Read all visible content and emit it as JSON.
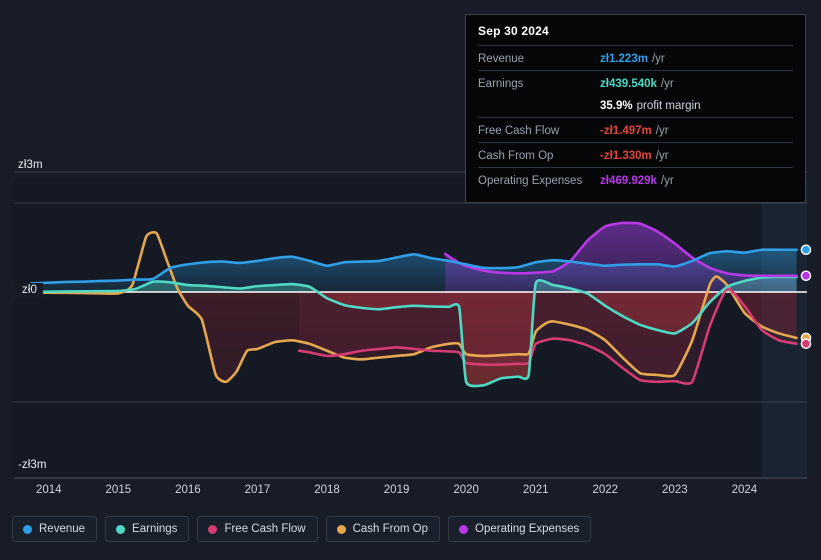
{
  "tooltip": {
    "date": "Sep 30 2024",
    "rows": [
      {
        "label": "Revenue",
        "value": "zł1.223m",
        "unit": "/yr",
        "color": "#2f9fe8"
      },
      {
        "label": "Earnings",
        "value": "zł439.540k",
        "unit": "/yr",
        "color": "#4fd8c4"
      },
      {
        "label": "",
        "value": "35.9%",
        "unit": "profit margin",
        "color": "#ffffff"
      },
      {
        "label": "Free Cash Flow",
        "value": "-zł1.497m",
        "unit": "/yr",
        "color": "#e4453a"
      },
      {
        "label": "Cash From Op",
        "value": "-zł1.330m",
        "unit": "/yr",
        "color": "#e4453a"
      },
      {
        "label": "Operating Expenses",
        "value": "zł469.929k",
        "unit": "/yr",
        "color": "#b838e8"
      }
    ]
  },
  "legend": {
    "items": [
      {
        "label": "Revenue",
        "color": "#2f9fe8"
      },
      {
        "label": "Earnings",
        "color": "#4fd8c4"
      },
      {
        "label": "Free Cash Flow",
        "color": "#d63b74"
      },
      {
        "label": "Cash From Op",
        "color": "#e5a84e"
      },
      {
        "label": "Operating Expenses",
        "color": "#b838e8"
      }
    ]
  },
  "chart_data": {
    "type": "area",
    "title": "",
    "xlabel": "",
    "ylabel": "",
    "currency": "zł",
    "grid": true,
    "legend_position": "bottom",
    "ylim": [
      -3000000,
      3000000
    ],
    "ytick_labels": [
      "zł3m",
      "zł0",
      "-zł3m"
    ],
    "ytick_values": [
      3000000,
      0,
      -3000000
    ],
    "xlim": [
      2013.5,
      2024.9
    ],
    "xtick_labels": [
      "2014",
      "2015",
      "2016",
      "2017",
      "2018",
      "2019",
      "2020",
      "2021",
      "2022",
      "2023",
      "2024"
    ],
    "xtick_values": [
      2014,
      2015,
      2016,
      2017,
      2018,
      2019,
      2020,
      2021,
      2022,
      2023,
      2024
    ],
    "forecast_start": 2024.25,
    "series": [
      {
        "name": "Revenue",
        "color": "#2f9fe8",
        "x": [
          2013.75,
          2014.0,
          2014.25,
          2014.5,
          2014.75,
          2015.0,
          2015.25,
          2015.5,
          2015.75,
          2016.0,
          2016.25,
          2016.5,
          2016.75,
          2017.0,
          2017.25,
          2017.5,
          2017.75,
          2018.0,
          2018.25,
          2018.5,
          2018.75,
          2019.0,
          2019.25,
          2019.5,
          2019.75,
          2020.0,
          2020.25,
          2020.5,
          2020.75,
          2021.0,
          2021.25,
          2021.5,
          2021.75,
          2022.0,
          2022.25,
          2022.5,
          2022.75,
          2023.0,
          2023.25,
          2023.5,
          2023.75,
          2024.0,
          2024.25,
          2024.5,
          2024.75
        ],
        "values": [
          250000,
          270000,
          290000,
          300000,
          320000,
          330000,
          360000,
          380000,
          700000,
          800000,
          860000,
          880000,
          840000,
          900000,
          980000,
          1020000,
          900000,
          760000,
          860000,
          880000,
          900000,
          1000000,
          1090000,
          980000,
          900000,
          800000,
          700000,
          690000,
          720000,
          860000,
          920000,
          880000,
          820000,
          760000,
          790000,
          800000,
          800000,
          740000,
          900000,
          1120000,
          1180000,
          1140000,
          1223000,
          1223000,
          1223000
        ]
      },
      {
        "name": "Earnings",
        "color": "#4fd8c4",
        "x": [
          2013.75,
          2014.0,
          2014.5,
          2015.0,
          2015.25,
          2015.5,
          2015.75,
          2016.0,
          2016.25,
          2016.5,
          2016.75,
          2017.0,
          2017.25,
          2017.5,
          2017.75,
          2018.0,
          2018.25,
          2018.5,
          2018.75,
          2019.0,
          2019.25,
          2019.5,
          2019.75,
          2019.9,
          2020.0,
          2020.25,
          2020.5,
          2020.75,
          2020.9,
          2021.0,
          2021.25,
          2021.5,
          2021.75,
          2022.0,
          2022.25,
          2022.5,
          2022.75,
          2023.0,
          2023.25,
          2023.5,
          2023.75,
          2024.0,
          2024.25,
          2024.5,
          2024.75
        ],
        "values": [
          0,
          10000,
          20000,
          30000,
          90000,
          300000,
          280000,
          200000,
          180000,
          140000,
          100000,
          170000,
          200000,
          230000,
          150000,
          -180000,
          -380000,
          -460000,
          -500000,
          -440000,
          -400000,
          -420000,
          -430000,
          -440000,
          -2600000,
          -2700000,
          -2500000,
          -2450000,
          -2400000,
          250000,
          200000,
          100000,
          -50000,
          -400000,
          -700000,
          -950000,
          -1100000,
          -1200000,
          -900000,
          -300000,
          150000,
          320000,
          420000,
          439540,
          439540
        ]
      },
      {
        "name": "Free Cash Flow",
        "color": "#d63b74",
        "x": [
          2017.6,
          2017.75,
          2018.0,
          2018.25,
          2018.5,
          2018.75,
          2019.0,
          2019.25,
          2019.5,
          2019.75,
          2019.9,
          2020.0,
          2020.25,
          2020.5,
          2020.75,
          2020.9,
          2021.0,
          2021.25,
          2021.5,
          2021.75,
          2022.0,
          2022.25,
          2022.5,
          2022.75,
          2023.0,
          2023.25,
          2023.5,
          2023.75,
          2024.0,
          2024.25,
          2024.5,
          2024.75
        ],
        "values": [
          -1700000,
          -1750000,
          -1850000,
          -1800000,
          -1700000,
          -1650000,
          -1600000,
          -1650000,
          -1700000,
          -1720000,
          -1750000,
          -2050000,
          -2100000,
          -2100000,
          -2080000,
          -2050000,
          -1500000,
          -1350000,
          -1400000,
          -1550000,
          -1800000,
          -2200000,
          -2550000,
          -2600000,
          -2580000,
          -2600000,
          -1000000,
          100000,
          -400000,
          -1100000,
          -1400000,
          -1497000
        ]
      },
      {
        "name": "Cash From Op",
        "color": "#e5a84e",
        "x": [
          2013.75,
          2014.0,
          2014.5,
          2015.0,
          2015.2,
          2015.4,
          2015.55,
          2015.7,
          2015.85,
          2016.0,
          2016.2,
          2016.4,
          2016.55,
          2016.7,
          2016.85,
          2017.0,
          2017.25,
          2017.5,
          2017.75,
          2018.0,
          2018.25,
          2018.5,
          2018.75,
          2019.0,
          2019.25,
          2019.5,
          2019.75,
          2019.9,
          2020.0,
          2020.25,
          2020.5,
          2020.75,
          2020.9,
          2021.0,
          2021.15,
          2021.25,
          2021.5,
          2021.75,
          2022.0,
          2022.25,
          2022.5,
          2022.75,
          2023.0,
          2023.25,
          2023.5,
          2023.6,
          2023.75,
          2024.0,
          2024.25,
          2024.5,
          2024.75
        ],
        "values": [
          -20000,
          -20000,
          -30000,
          -40000,
          200000,
          1600000,
          1700000,
          900000,
          100000,
          -400000,
          -800000,
          -2400000,
          -2600000,
          -2300000,
          -1700000,
          -1650000,
          -1450000,
          -1400000,
          -1500000,
          -1700000,
          -1900000,
          -1950000,
          -1900000,
          -1850000,
          -1800000,
          -1600000,
          -1500000,
          -1500000,
          -1800000,
          -1850000,
          -1830000,
          -1800000,
          -1780000,
          -1150000,
          -900000,
          -850000,
          -950000,
          -1100000,
          -1400000,
          -1900000,
          -2350000,
          -2400000,
          -2400000,
          -1400000,
          200000,
          450000,
          200000,
          -600000,
          -1000000,
          -1200000,
          -1330000
        ]
      },
      {
        "name": "Operating Expenses",
        "color": "#b838e8",
        "x": [
          2019.7,
          2019.85,
          2020.0,
          2020.25,
          2020.5,
          2020.75,
          2021.0,
          2021.25,
          2021.5,
          2021.75,
          2022.0,
          2022.25,
          2022.5,
          2022.75,
          2023.0,
          2023.25,
          2023.5,
          2023.75,
          2024.0,
          2024.25,
          2024.5,
          2024.75
        ],
        "values": [
          1100000,
          900000,
          750000,
          620000,
          560000,
          540000,
          560000,
          600000,
          900000,
          1500000,
          1900000,
          2000000,
          1980000,
          1750000,
          1400000,
          1000000,
          700000,
          540000,
          480000,
          470000,
          469929,
          469929
        ]
      }
    ],
    "endpoints": [
      {
        "name": "Revenue",
        "value": 1223000,
        "color": "#2f9fe8"
      },
      {
        "name": "Operating Expenses",
        "value": 469929,
        "color": "#b838e8"
      },
      {
        "name": "Cash From Op",
        "value": -1330000,
        "color": "#e5a84e"
      },
      {
        "name": "Free Cash Flow",
        "value": -1497000,
        "color": "#d63b74"
      }
    ]
  }
}
